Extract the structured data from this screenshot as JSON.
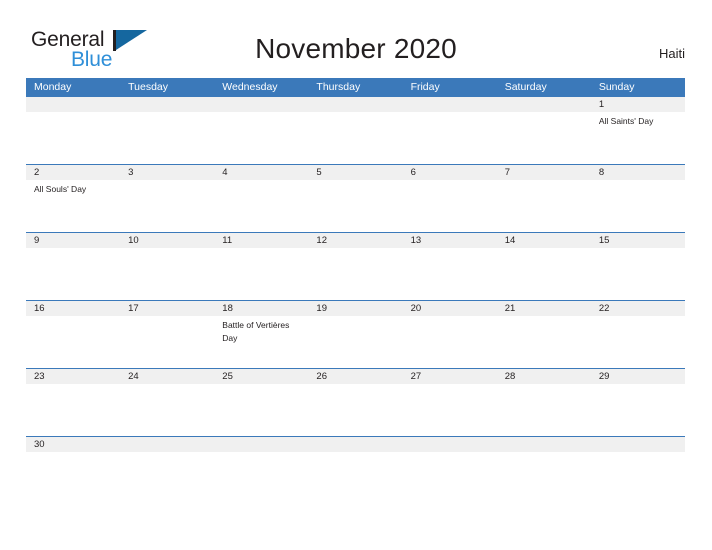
{
  "brand": {
    "name_part1": "General",
    "name_part2": "Blue",
    "flag_color": "#15679f",
    "blue_color": "#2f8fd8"
  },
  "header": {
    "title": "November 2020",
    "country": "Haiti"
  },
  "theme": {
    "header_blue": "#3b79ba",
    "daynum_bg": "#f0f0f0",
    "rule_blue": "#3b79ba",
    "text": "#231f20"
  },
  "weekdays": [
    "Monday",
    "Tuesday",
    "Wednesday",
    "Thursday",
    "Friday",
    "Saturday",
    "Sunday"
  ],
  "weeks": [
    {
      "days": [
        {
          "num": "",
          "event": ""
        },
        {
          "num": "",
          "event": ""
        },
        {
          "num": "",
          "event": ""
        },
        {
          "num": "",
          "event": ""
        },
        {
          "num": "",
          "event": ""
        },
        {
          "num": "",
          "event": ""
        },
        {
          "num": "1",
          "event": "All Saints' Day"
        }
      ]
    },
    {
      "days": [
        {
          "num": "2",
          "event": "All Souls' Day"
        },
        {
          "num": "3",
          "event": ""
        },
        {
          "num": "4",
          "event": ""
        },
        {
          "num": "5",
          "event": ""
        },
        {
          "num": "6",
          "event": ""
        },
        {
          "num": "7",
          "event": ""
        },
        {
          "num": "8",
          "event": ""
        }
      ]
    },
    {
      "days": [
        {
          "num": "9",
          "event": ""
        },
        {
          "num": "10",
          "event": ""
        },
        {
          "num": "11",
          "event": ""
        },
        {
          "num": "12",
          "event": ""
        },
        {
          "num": "13",
          "event": ""
        },
        {
          "num": "14",
          "event": ""
        },
        {
          "num": "15",
          "event": ""
        }
      ]
    },
    {
      "days": [
        {
          "num": "16",
          "event": ""
        },
        {
          "num": "17",
          "event": ""
        },
        {
          "num": "18",
          "event": "Battle of Vertières Day"
        },
        {
          "num": "19",
          "event": ""
        },
        {
          "num": "20",
          "event": ""
        },
        {
          "num": "21",
          "event": ""
        },
        {
          "num": "22",
          "event": ""
        }
      ]
    },
    {
      "days": [
        {
          "num": "23",
          "event": ""
        },
        {
          "num": "24",
          "event": ""
        },
        {
          "num": "25",
          "event": ""
        },
        {
          "num": "26",
          "event": ""
        },
        {
          "num": "27",
          "event": ""
        },
        {
          "num": "28",
          "event": ""
        },
        {
          "num": "29",
          "event": ""
        }
      ]
    },
    {
      "days": [
        {
          "num": "30",
          "event": ""
        },
        {
          "num": "",
          "event": ""
        },
        {
          "num": "",
          "event": ""
        },
        {
          "num": "",
          "event": ""
        },
        {
          "num": "",
          "event": ""
        },
        {
          "num": "",
          "event": ""
        },
        {
          "num": "",
          "event": ""
        }
      ]
    }
  ]
}
